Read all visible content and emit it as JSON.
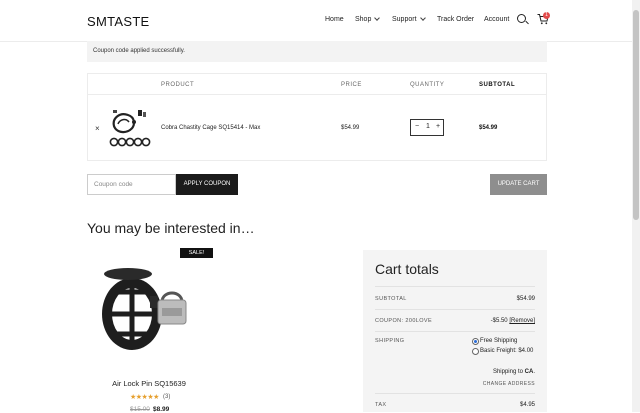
{
  "header": {
    "logo": "SMTASTE",
    "nav": [
      {
        "label": "Home",
        "dropdown": false
      },
      {
        "label": "Shop",
        "dropdown": true
      },
      {
        "label": "Support",
        "dropdown": true
      },
      {
        "label": "Track Order",
        "dropdown": false
      },
      {
        "label": "Account",
        "dropdown": false
      }
    ],
    "cart_count": "1"
  },
  "notice": "Coupon code applied successfully.",
  "cart_table": {
    "headers": {
      "product": "PRODUCT",
      "price": "PRICE",
      "quantity": "QUANTITY",
      "subtotal": "SUBTOTAL"
    },
    "row": {
      "remove": "×",
      "name": "Cobra Chastity Cage SQ15414 - Max",
      "price": "$54.99",
      "qty_minus": "−",
      "quantity": "1",
      "qty_plus": "+",
      "subtotal": "$54.99"
    }
  },
  "coupon": {
    "placeholder": "Coupon code",
    "apply_label": "APPLY COUPON"
  },
  "update_cart_label": "UPDATE CART",
  "interested": {
    "heading": "You may be interested in…",
    "product": {
      "sale_badge": "SALE!",
      "name": "Air Lock Pin SQ15639",
      "rating": 5,
      "stars": "★★★★★",
      "reviews": "(3)",
      "old_price": "$15.00",
      "new_price": "$8.99"
    }
  },
  "cart_totals": {
    "title": "Cart totals",
    "subtotal_label": "SUBTOTAL",
    "subtotal_value": "$54.99",
    "coupon_label": "COUPON: 200LOVE",
    "coupon_value": "-$5.50",
    "coupon_remove": "[Remove]",
    "shipping_label": "SHIPPING",
    "shipping_options": [
      {
        "label": "Free Shipping",
        "selected": true
      },
      {
        "label": "Basic Freight: $4.00",
        "selected": false
      }
    ],
    "shipping_to_prefix": "Shipping to ",
    "shipping_to_region": "CA",
    "shipping_to_suffix": ".",
    "change_address": "CHANGE ADDRESS",
    "tax_label": "TAX",
    "tax_value": "$4.95"
  },
  "colors": {
    "accent_dark": "#1b1b1b",
    "badge_red": "#e24b4b",
    "star": "#e6a02f",
    "update_gray": "#8e8e8e"
  }
}
